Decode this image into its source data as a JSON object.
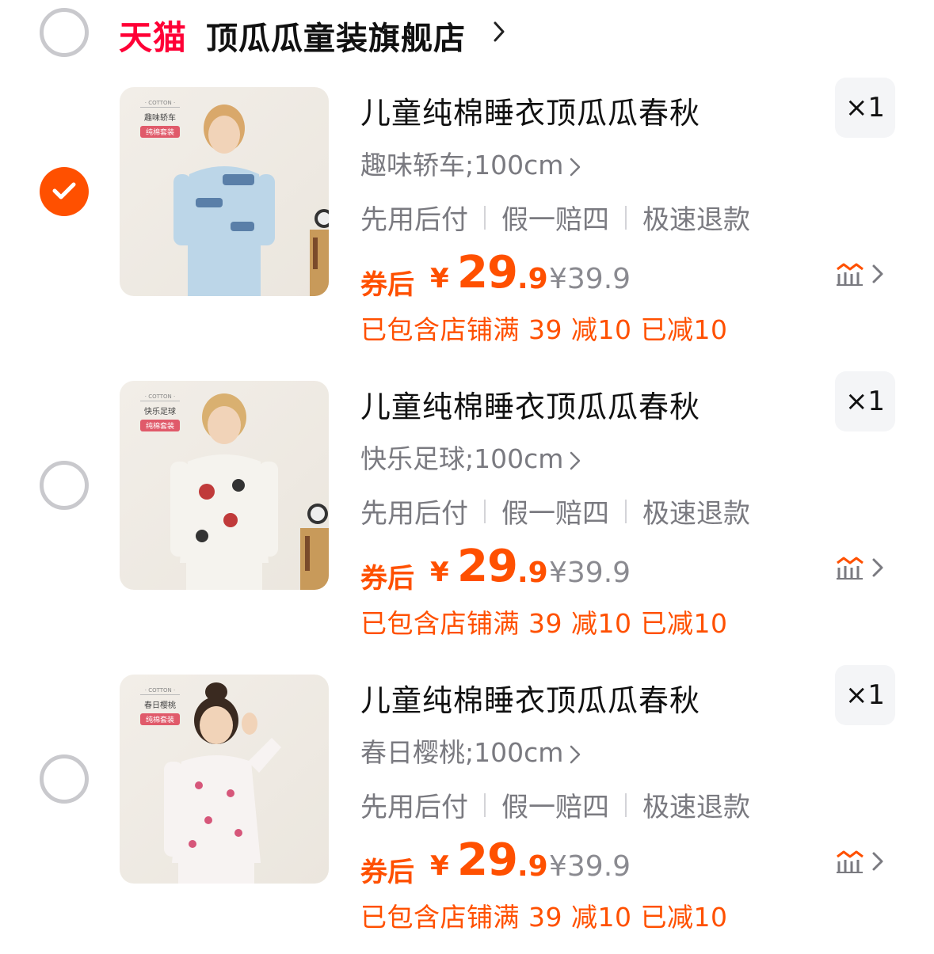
{
  "store": {
    "brand_logo": "天猫",
    "name": "顶瓜瓜童装旗舰店",
    "selected": false
  },
  "items": [
    {
      "title": "儿童纯棉睡衣顶瓜瓜春秋",
      "sku": "趣味轿车;100cm",
      "services": [
        "先用后付",
        "假一赔四",
        "极速退款"
      ],
      "price_label": "券后",
      "currency": "¥",
      "price_int": "29",
      "price_dec": ".9",
      "original_price": "¥39.9",
      "promo": "已包含店铺满 39 减10 已减10",
      "quantity": "×1",
      "selected": true,
      "thumb_tag": {
        "cotton": "· COTTON ·",
        "name": "趣味轿车",
        "set": "纯棉套装"
      },
      "thumb_color": "#bcd6e8"
    },
    {
      "title": "儿童纯棉睡衣顶瓜瓜春秋",
      "sku": "快乐足球;100cm",
      "services": [
        "先用后付",
        "假一赔四",
        "极速退款"
      ],
      "price_label": "券后",
      "currency": "¥",
      "price_int": "29",
      "price_dec": ".9",
      "original_price": "¥39.9",
      "promo": "已包含店铺满 39 减10 已减10",
      "quantity": "×1",
      "selected": false,
      "thumb_tag": {
        "cotton": "· COTTON ·",
        "name": "快乐足球",
        "set": "纯棉套装"
      },
      "thumb_color": "#f3f1ec"
    },
    {
      "title": "儿童纯棉睡衣顶瓜瓜春秋",
      "sku": "春日樱桃;100cm",
      "services": [
        "先用后付",
        "假一赔四",
        "极速退款"
      ],
      "price_label": "券后",
      "currency": "¥",
      "price_int": "29",
      "price_dec": ".9",
      "original_price": "¥39.9",
      "promo": "已包含店铺满 39 减10 已减10",
      "quantity": "×1",
      "selected": false,
      "thumb_tag": {
        "cotton": "· COTTON ·",
        "name": "春日樱桃",
        "set": "纯棉套装"
      },
      "thumb_color": "#f5f0ef"
    }
  ],
  "colors": {
    "accent": "#ff5000",
    "tmall_red": "#ff0036",
    "muted_text": "#7a7a80"
  },
  "icons": {
    "check": "check-icon",
    "chevron": "chevron-right-icon",
    "trend": "price-trend-icon"
  }
}
